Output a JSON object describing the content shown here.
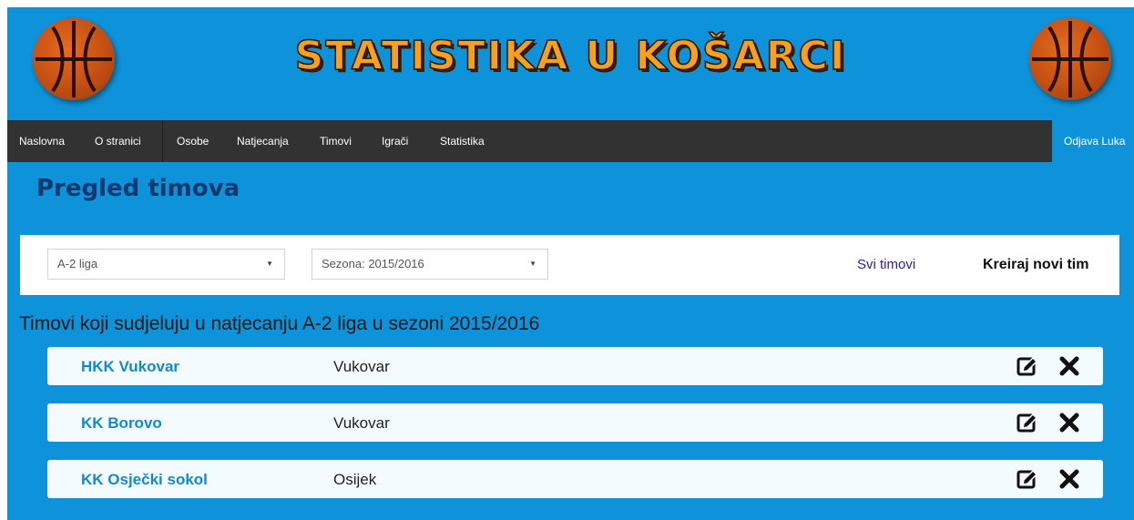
{
  "header": {
    "title": "STATISTIKA U KOŠARCI",
    "logo_icon": "basketball-icon",
    "title_color": "#f5a020"
  },
  "nav": {
    "items": [
      "Naslovna",
      "O stranici",
      "Osobe",
      "Natjecanja",
      "Timovi",
      "Igrači",
      "Statistika"
    ],
    "logout": "Odjava Luka"
  },
  "page": {
    "heading": "Pregled timova"
  },
  "filters": {
    "league": "A-2 liga",
    "season": "Sezona: 2015/2016",
    "all_teams_link": "Svi timovi",
    "create_team": "Kreiraj novi tim"
  },
  "list": {
    "caption": "Timovi koji sudjeluju u natjecanju A-2 liga u sezoni 2015/2016",
    "edit_icon": "edit-icon",
    "delete_icon": "close-icon",
    "teams": [
      {
        "name": "HKK Vukovar",
        "city": "Vukovar"
      },
      {
        "name": "KK Borovo",
        "city": "Vukovar"
      },
      {
        "name": "KK Osječki sokol",
        "city": "Osijek"
      }
    ]
  },
  "colors": {
    "background": "#0e93da",
    "navbar": "#323232",
    "heading": "#12386e",
    "team_link": "#1488cc"
  }
}
